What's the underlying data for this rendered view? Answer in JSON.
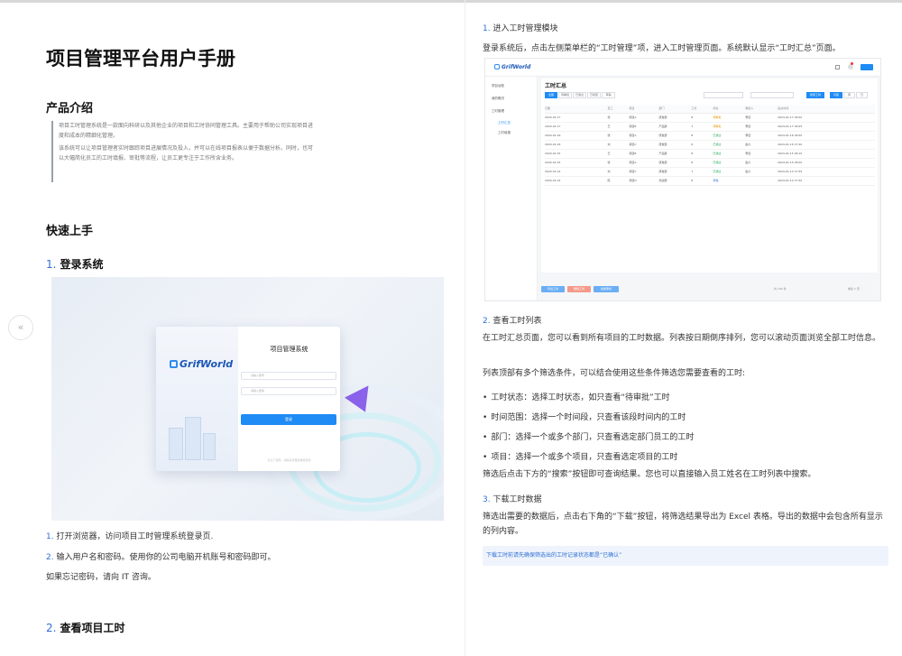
{
  "nav": {
    "prev_icon": "«"
  },
  "left": {
    "title": "项目管理平台用户手册",
    "intro": {
      "heading": "产品介绍",
      "p1": "项目工时管理系统是一款面向科研以及其他企业的项目和工时协同管理工具。主要用于帮助公司实现项目进度和成本的精细化管理。",
      "p2": "该系统可以让项目管理者实时跟踪项目进展情况及投入，并可以在线项目报表以便于数据分析。同时，也可以大幅简化员工的工时填报、审批等流程，让员工更专注于工作所含业务。"
    },
    "quickstart": {
      "heading": "快速上手",
      "s1_num": "1.",
      "s1_title": "登录系统",
      "login_ui": {
        "logo": "GrifWorld",
        "title": "项目管理系统",
        "user_ph": "请输入账号",
        "pwd_ph": "请输入密码",
        "btn": "登录",
        "footer": "忘记了密码，请联系管理员重置密码"
      },
      "step1_num": "1.",
      "step1_text": "打开浏览器，访问项目工时管理系统登录页.",
      "step2_num": "2.",
      "step2_text": "输入用户名和密码。使用你的公司电脑开机账号和密码即可。",
      "note": "如果忘记密码，请向 IT 咨询。",
      "s2_num": "2.",
      "s2_title": "查看项目工时"
    }
  },
  "right": {
    "s1_num": "1.",
    "s1_title": "进入工时管理模块",
    "s1_text": "登录系统后，点击左侧菜单栏的“工时管理”项，进入工时管理页面。系统默认显示“工时汇总”页面。",
    "shot": {
      "logo": "GrifWorld",
      "side": [
        "项目台账",
        "我的概况",
        "工时管理",
        "工时汇总",
        "工时填报"
      ],
      "title": "工时汇总",
      "tabs": [
        "全部",
        "待审批",
        "已通过",
        "已驳回",
        "草稿"
      ],
      "search_btn": "搜索工时",
      "view_btns": [
        "月度",
        "周",
        "日"
      ],
      "headers": [
        "日期",
        "员工",
        "项目",
        "部门",
        "工时",
        "状态",
        "审批人",
        "提交时间"
      ],
      "rows": [
        [
          "2024-01-17",
          "张",
          "项目A",
          "研发部",
          "8",
          "待审批",
          "李四",
          "2024-01-17 18:00"
        ],
        [
          "2024-01-17",
          "王",
          "项目B",
          "产品部",
          "7",
          "待审批",
          "李四",
          "2024-01-17 18:05"
        ],
        [
          "2024-01-16",
          "张",
          "项目A",
          "研发部",
          "8",
          "已通过",
          "李四",
          "2024-01-16 18:00"
        ],
        [
          "2024-01-16",
          "刘",
          "项目C",
          "研发部",
          "6",
          "已通过",
          "赵六",
          "2024-01-16 17:40"
        ],
        [
          "2024-01-15",
          "王",
          "项目B",
          "产品部",
          "8",
          "已通过",
          "李四",
          "2024-01-15 18:10"
        ],
        [
          "2024-01-15",
          "张",
          "项目A",
          "研发部",
          "8",
          "已通过",
          "赵六",
          "2024-01-15 18:00"
        ],
        [
          "2024-01-14",
          "刘",
          "项目C",
          "研发部",
          "7",
          "已通过",
          "赵六",
          "2024-01-14 17:55"
        ],
        [
          "2024-01-14",
          "陈",
          "项目D",
          "测试部",
          "8",
          "草稿",
          "",
          "2024-01-14 17:50"
        ]
      ],
      "foot_btns": [
        "导出工时",
        "删除工时",
        "批量审批"
      ],
      "foot_total": "共 100 条",
      "foot_page": "前往 1 页"
    },
    "s2_num": "2.",
    "s2_title": "查看工时列表",
    "s2_p1": "在工时汇总页面，您可以看到所有项目的工时数据。列表按日期倒序排列，您可以滚动页面浏览全部工时信息。",
    "s2_p2": "列表顶部有多个筛选条件，可以结合使用这些条件筛选您需要查看的工时:",
    "bullets": [
      "工时状态：选择工时状态，如只查看“待审批”工时",
      "时间范围：选择一个时间段，只查看该段时间内的工时",
      "部门：选择一个或多个部门，只查看选定部门员工的工时",
      "项目：选择一个或多个项目，只查看选定项目的工时"
    ],
    "s2_p3": "筛选后点击下方的“搜索”按钮即可查询结果。您也可以直接输入员工姓名在工时列表中搜索。",
    "s3_num": "3.",
    "s3_title": "下载工时数据",
    "s3_text": "筛选出需要的数据后，点击右下角的“下载”按钮，将筛选结果导出为 Excel 表格。导出的数据中会包含所有显示的列内容。",
    "tip": "下载工时前请先确保筛选出的工时记录状态都是“已确认”"
  }
}
